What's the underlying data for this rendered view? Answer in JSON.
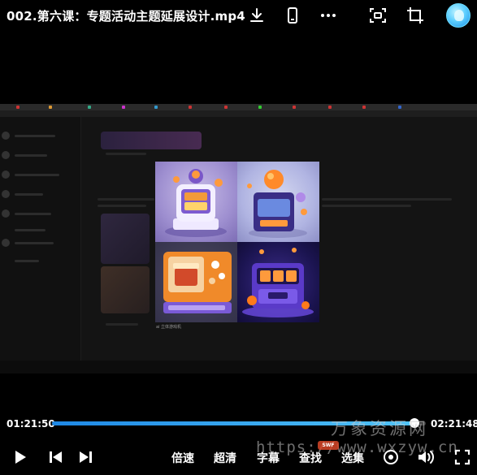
{
  "header": {
    "title": "002.第六课：专题活动主题延展设计.mp4",
    "icons": [
      "download-icon",
      "phone-icon",
      "more-icon",
      "screenshot-icon",
      "crop-icon",
      "avatar"
    ]
  },
  "video": {
    "grid_caption": "ai 立体游戏机"
  },
  "player": {
    "current_time": "01:21:50",
    "total_time": "02:21:48",
    "progress": 0.97,
    "accent_color": "#1e88e5",
    "buttons": {
      "speed": "倍速",
      "quality": "超清",
      "subtitle": "字幕",
      "search": "查找",
      "episodes": "选集"
    }
  },
  "watermark": {
    "cn_text": "万象资源网",
    "url_text": "https://www.wxzyw.cn",
    "badge_text": "SWF"
  }
}
